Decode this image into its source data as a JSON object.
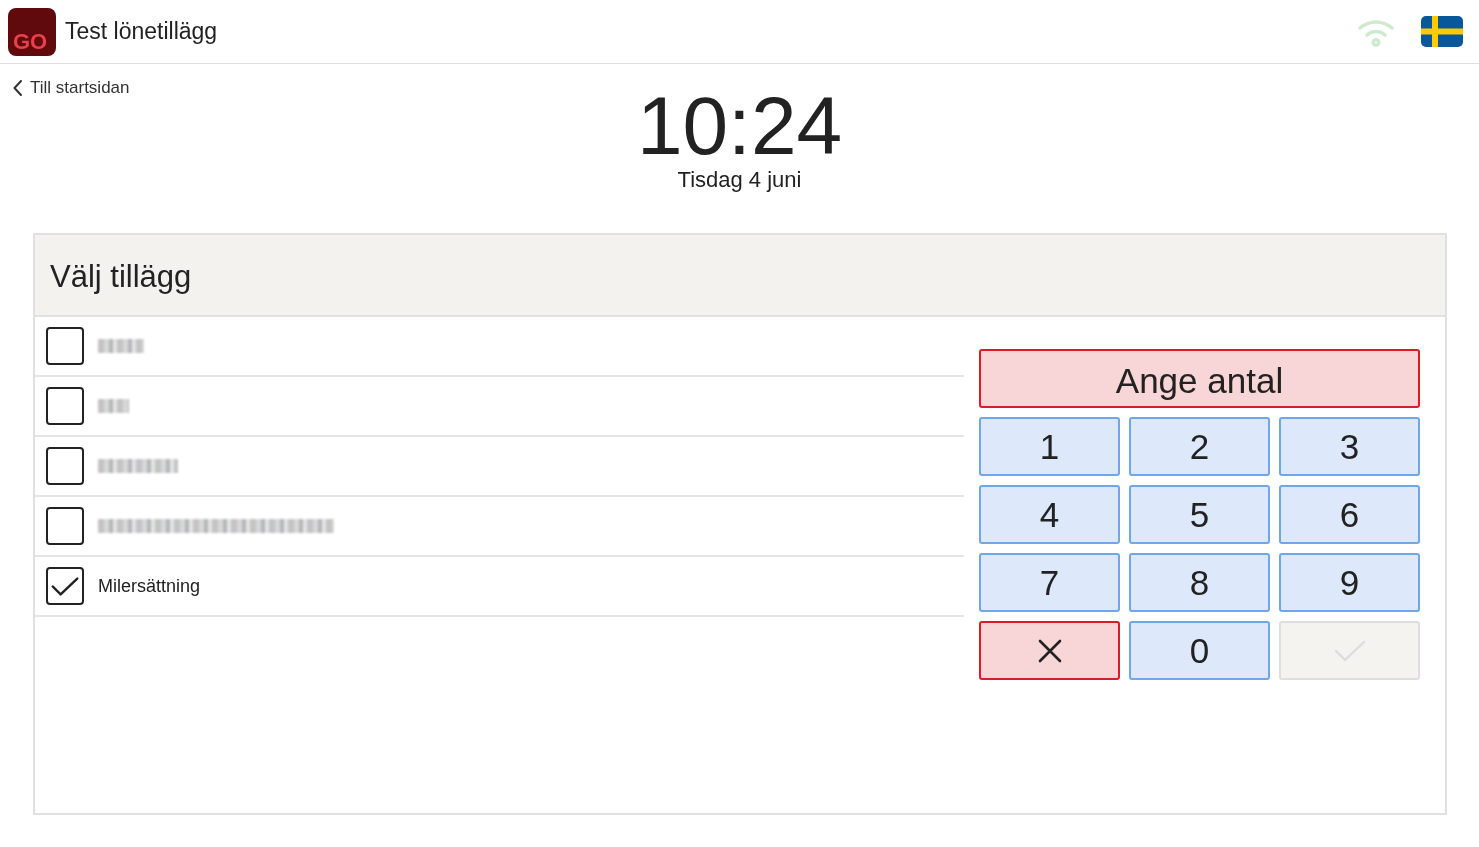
{
  "header": {
    "logo": "GO",
    "title": "Test lönetillägg"
  },
  "back_link": {
    "label": "Till startsidan"
  },
  "clock": {
    "time": "10:24",
    "date": "Tisdag 4 juni"
  },
  "panel": {
    "title": "Välj tillägg",
    "items": [
      {
        "kind": "redacted",
        "checked": false
      },
      {
        "kind": "redacted",
        "checked": false
      },
      {
        "kind": "redacted",
        "checked": false
      },
      {
        "kind": "redacted",
        "checked": false
      },
      {
        "kind": "text",
        "label": "Milersättning",
        "checked": true
      }
    ],
    "amount_field": {
      "placeholder": "Ange antal",
      "invalid": true
    },
    "keys": [
      {
        "kind": "digit",
        "label": "1",
        "disabled": false
      },
      {
        "kind": "digit",
        "label": "2",
        "disabled": false
      },
      {
        "kind": "digit",
        "label": "3",
        "disabled": false
      },
      {
        "kind": "digit",
        "label": "4",
        "disabled": false
      },
      {
        "kind": "digit",
        "label": "5",
        "disabled": false
      },
      {
        "kind": "digit",
        "label": "6",
        "disabled": false
      },
      {
        "kind": "digit",
        "label": "7",
        "disabled": false
      },
      {
        "kind": "digit",
        "label": "8",
        "disabled": false
      },
      {
        "kind": "digit",
        "label": "9",
        "disabled": false
      },
      {
        "kind": "clear",
        "disabled": false
      },
      {
        "kind": "digit",
        "label": "0",
        "disabled": false
      },
      {
        "kind": "confirm",
        "disabled": true
      }
    ]
  }
}
